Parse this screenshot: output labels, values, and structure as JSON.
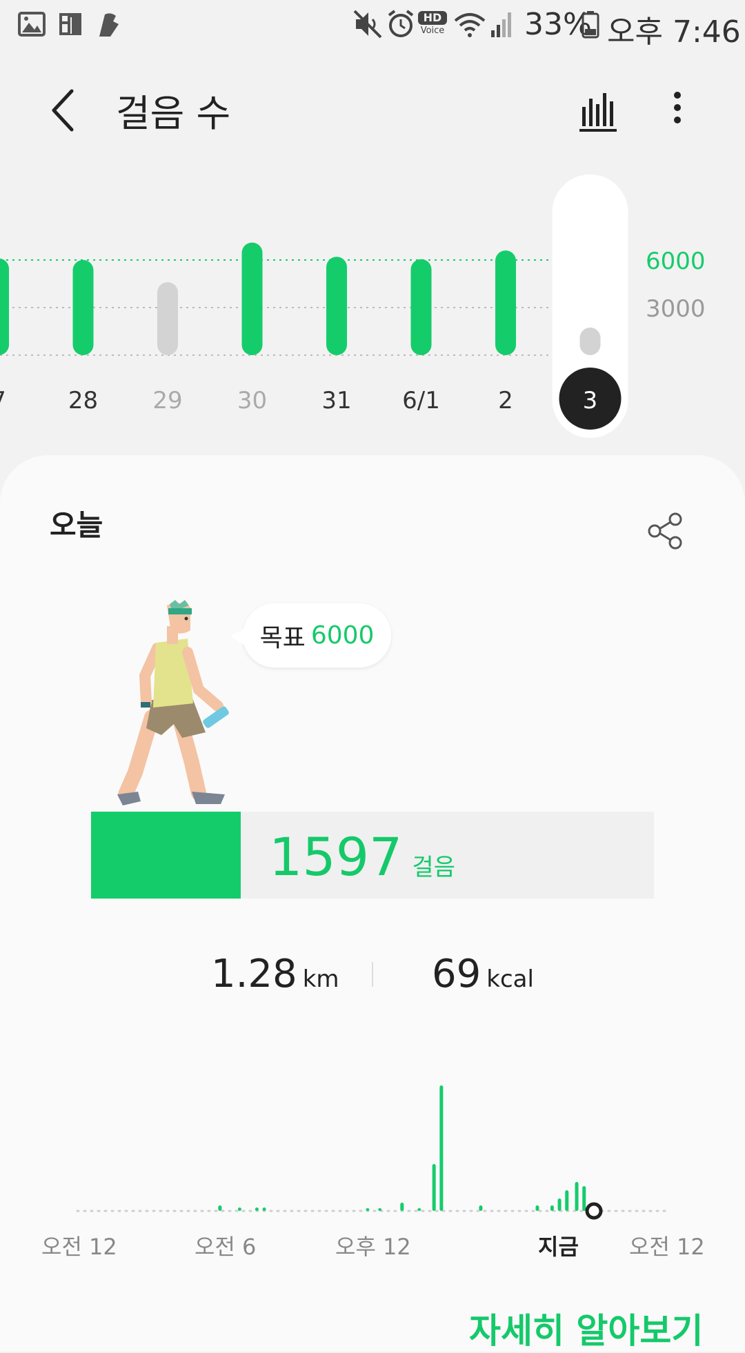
{
  "status_bar": {
    "left_icons": [
      "gallery-icon",
      "news-icon",
      "shoe-icon"
    ],
    "right_icons": [
      "mute-icon",
      "alarm-icon",
      "hd-voice-icon",
      "wifi-icon",
      "signal-icon",
      "battery-icon"
    ],
    "hd_label": "HD",
    "voice_label": "Voice",
    "battery": "33%",
    "time": "오후 7:46"
  },
  "header": {
    "title": "걸음 수",
    "back_icon": "back-arrow-icon",
    "chart_icon": "bar-chart-icon",
    "more_icon": "more-vert-icon"
  },
  "week_chart": {
    "days": [
      "7",
      "28",
      "29",
      "30",
      "31",
      "6/1",
      "2",
      "3"
    ],
    "values": [
      6100,
      6000,
      4600,
      7100,
      6200,
      6050,
      6600,
      1597
    ],
    "met_goal": [
      true,
      true,
      false,
      true,
      true,
      true,
      true,
      false
    ],
    "label_dim": [
      false,
      false,
      true,
      true,
      false,
      false,
      false,
      false
    ],
    "selected": "3",
    "goal_line": 6000,
    "y_ticks": [
      "6000",
      "3000"
    ],
    "colors": {
      "met": "#15cc6b",
      "missed": "#d3d3d3"
    }
  },
  "today": {
    "label": "오늘",
    "share_icon": "share-icon",
    "goal_label": "목표",
    "goal_value": "6000",
    "steps": "1597",
    "steps_unit": "걸음",
    "progress_fraction": 0.266,
    "distance": "1.28",
    "distance_unit": "km",
    "calories": "69",
    "calories_unit": "kcal"
  },
  "day_chart": {
    "time_labels": [
      "오전 12",
      "오전 6",
      "오후 12",
      "지금",
      "오전 12"
    ],
    "now_label": "지금",
    "bars": [
      [
        5.8,
        8
      ],
      [
        6.6,
        5
      ],
      [
        7.3,
        5
      ],
      [
        7.6,
        5
      ],
      [
        11.8,
        4
      ],
      [
        12.3,
        4
      ],
      [
        13.2,
        12
      ],
      [
        13.9,
        4
      ],
      [
        14.5,
        68
      ],
      [
        14.8,
        182
      ],
      [
        16.4,
        8
      ],
      [
        18.7,
        8
      ],
      [
        19.3,
        8
      ],
      [
        19.6,
        18
      ],
      [
        19.9,
        30
      ],
      [
        20.3,
        42
      ],
      [
        20.6,
        36
      ]
    ],
    "now_hour": 21.0
  },
  "footer": {
    "more_link": "자세히 알아보기"
  },
  "accent": "#15cc6b"
}
